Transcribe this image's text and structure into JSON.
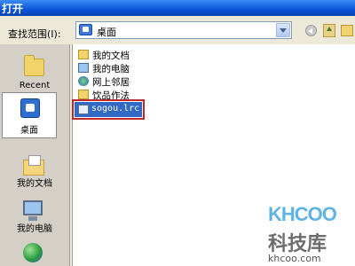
{
  "window": {
    "title": "打开"
  },
  "toolbar": {
    "lookin_label": "查找范围(I):",
    "lookin_value": "桌面"
  },
  "places": [
    {
      "label": "Recent"
    },
    {
      "label": "桌面"
    },
    {
      "label": "我的文档"
    },
    {
      "label": "我的电脑"
    }
  ],
  "files": [
    {
      "name": "我的文档"
    },
    {
      "name": "我的电脑"
    },
    {
      "name": "网上邻居"
    },
    {
      "name": "饮品作法"
    },
    {
      "name": "sogou.lrc"
    }
  ],
  "watermark": {
    "logo": "KHCOO",
    "cn": "科技库",
    "url": "khcoo.com"
  }
}
